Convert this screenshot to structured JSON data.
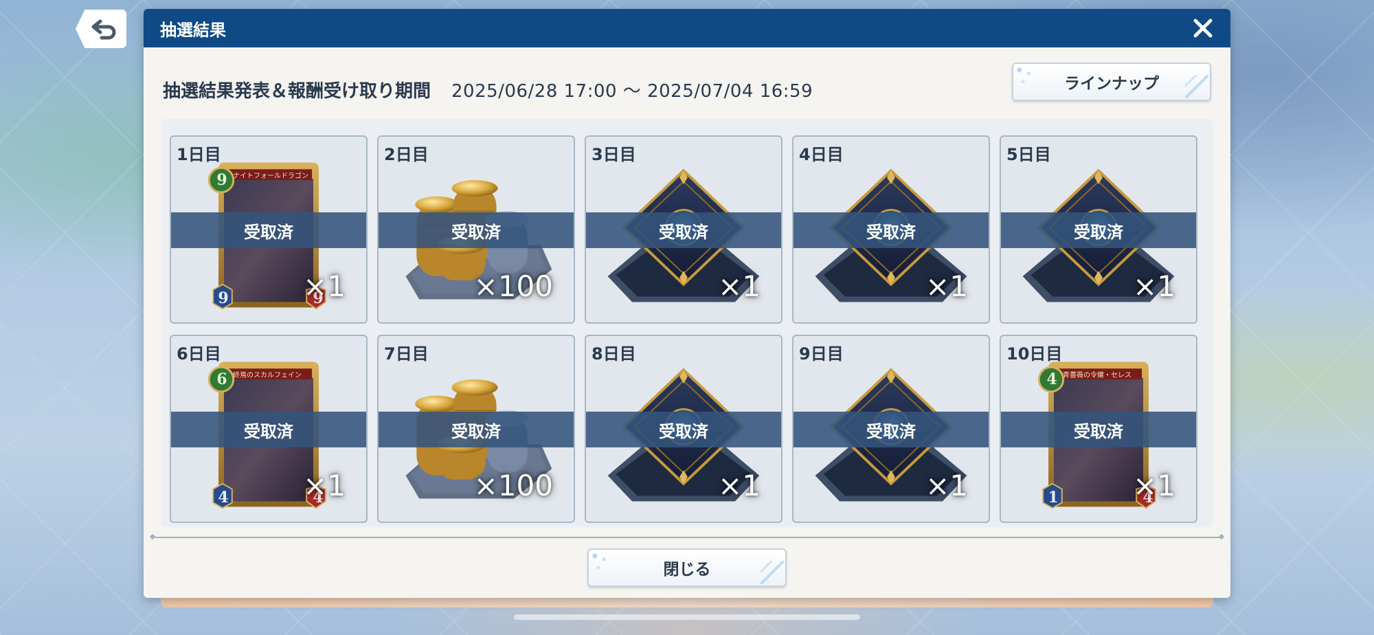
{
  "back_icon": "undo-arrow-icon",
  "dialog": {
    "title": "抽選結果",
    "close_icon": "close-x-icon",
    "period_label": "抽選結果発表＆報酬受け取り期間",
    "period_value": "2025/06/28 17:00 ～ 2025/07/04 16:59",
    "lineup_label": "ラインナップ",
    "close_label": "閉じる"
  },
  "days": [
    {
      "label": "1日目",
      "item": "card",
      "card_cost": "9",
      "card_atk": "9",
      "card_def": "9",
      "card_name": "ナイトフォールドラゴン",
      "qty": "×1",
      "status": "受取済"
    },
    {
      "label": "2日目",
      "item": "coins",
      "qty": "×100",
      "status": "受取済"
    },
    {
      "label": "3日目",
      "item": "sleeve",
      "qty": "×1",
      "status": "受取済"
    },
    {
      "label": "4日目",
      "item": "sleeve",
      "qty": "×1",
      "status": "受取済"
    },
    {
      "label": "5日目",
      "item": "sleeve",
      "qty": "×1",
      "status": "受取済"
    },
    {
      "label": "6日目",
      "item": "card",
      "card_cost": "6",
      "card_atk": "4",
      "card_def": "4",
      "card_name": "終焉のスカルフェイン",
      "qty": "×1",
      "status": "受取済"
    },
    {
      "label": "7日目",
      "item": "coins",
      "qty": "×100",
      "status": "受取済"
    },
    {
      "label": "8日目",
      "item": "sleeve",
      "qty": "×1",
      "status": "受取済"
    },
    {
      "label": "9日目",
      "item": "sleeve",
      "qty": "×1",
      "status": "受取済"
    },
    {
      "label": "10日目",
      "item": "card",
      "card_cost": "4",
      "card_atk": "1",
      "card_def": "4",
      "card_name": "青薔薇の令嬢・セレス",
      "qty": "×1",
      "status": "受取済"
    }
  ],
  "colors": {
    "header": "#0f4a86",
    "claimed_band": "#34547c",
    "card_frame": "#b8892f",
    "cost_gem": "#2f7a35",
    "coin": "#d6a43a"
  }
}
